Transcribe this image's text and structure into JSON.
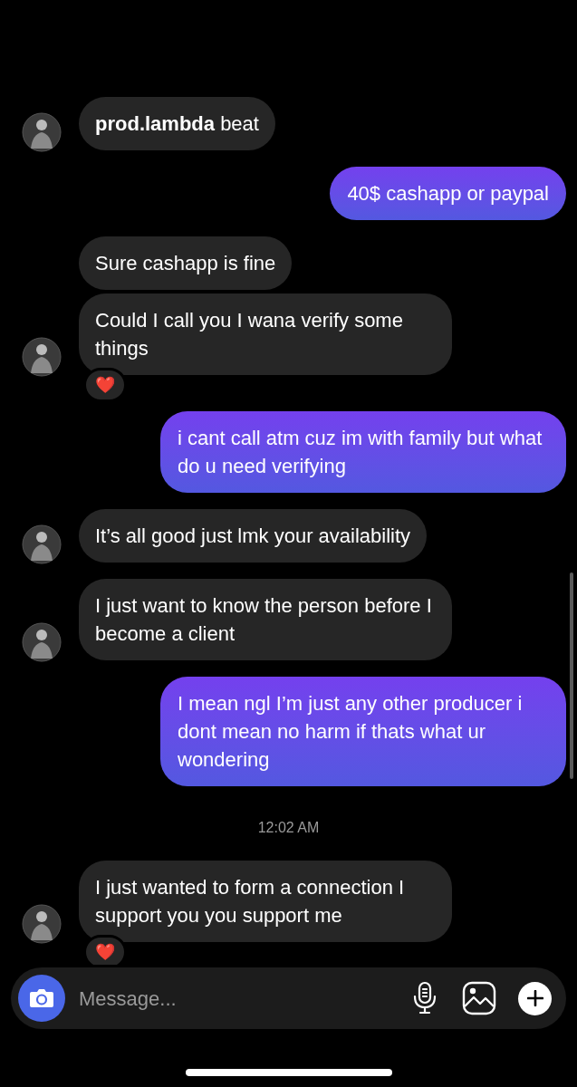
{
  "messages": [
    {
      "kind": "received",
      "text": "**prod.lambda** beat",
      "avatar": true
    },
    {
      "kind": "sent",
      "text": "40$ cashapp or paypal"
    },
    {
      "kind": "received",
      "text": "Sure cashapp is fine",
      "avatar": false
    },
    {
      "kind": "received",
      "text": "Could I call you I wana verify some things",
      "avatar": true,
      "reaction": "❤️"
    },
    {
      "kind": "sent",
      "text": "i cant call atm cuz im with family but what do u need verifying"
    },
    {
      "kind": "received",
      "text": "It’s all good just lmk your availability",
      "avatar": true
    },
    {
      "kind": "received",
      "text": "I just want to know the person before I become a client",
      "avatar": true
    },
    {
      "kind": "sent",
      "text": "I mean ngl I’m just any other producer i dont mean no harm if thats what ur wondering"
    },
    {
      "kind": "timestamp",
      "text": "12:02 AM"
    },
    {
      "kind": "received",
      "text": "I just wanted to form a connection I support you you support me",
      "avatar": true,
      "reaction": "❤️"
    }
  ],
  "composer": {
    "placeholder": "Message..."
  }
}
